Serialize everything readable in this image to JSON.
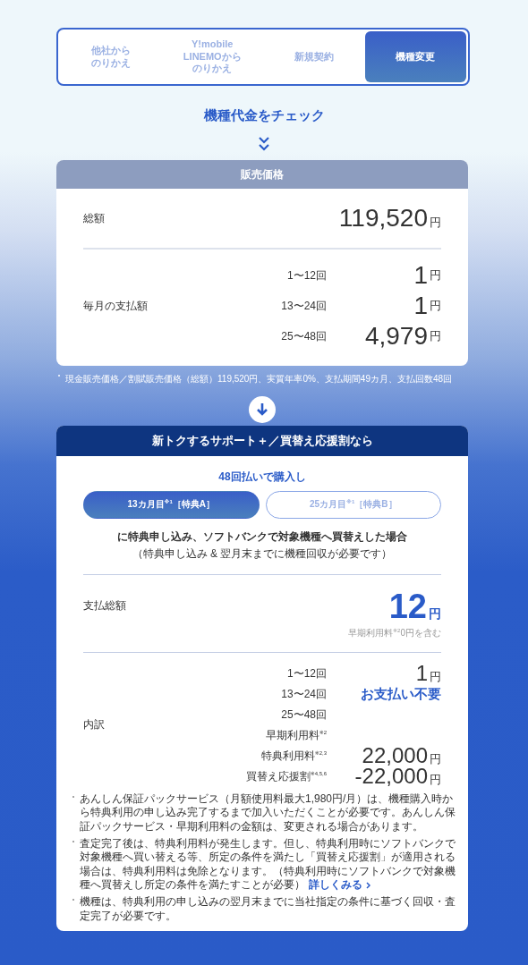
{
  "tabs": [
    {
      "lines": [
        "他社から",
        "のりかえ"
      ],
      "selected": false
    },
    {
      "lines": [
        "Y!mobile",
        "LINEMOから",
        "のりかえ"
      ],
      "selected": false
    },
    {
      "lines": [
        "新規契約"
      ],
      "selected": false
    },
    {
      "lines": [
        "機種変更"
      ],
      "selected": true
    }
  ],
  "heading": "機種代金をチェック",
  "price_card": {
    "title": "販売価格",
    "total": {
      "label": "総額",
      "amount": "119,520",
      "unit": "円"
    },
    "monthly": {
      "label": "毎月の支払額",
      "rows": [
        {
          "period": "1〜12回",
          "amount": "1",
          "unit": "円"
        },
        {
          "period": "13〜24回",
          "amount": "1",
          "unit": "円"
        },
        {
          "period": "25〜48回",
          "amount": "4,979",
          "unit": "円"
        }
      ]
    }
  },
  "price_note": "現金販売価格／割賦販売価格（総額）119,520円、実質年率0%、支払期間49カ月、支払回数48回",
  "plan_card": {
    "title": "新トクするサポート＋／買替え応援割なら",
    "subtitle": "48回払いで購入し",
    "options": [
      {
        "label": "13カ月目$^{※1}$［特典A］",
        "selected": true
      },
      {
        "label": "25カ月目$^{※1}$［特典B］",
        "selected": false
      }
    ],
    "condition": "に特典申し込み、ソフトバンクで対象機種へ買替えした場合",
    "condition_note": "（特典申し込み & 翌月末までに機種回収が必要です）",
    "total": {
      "label": "支払総額",
      "amount": "12",
      "unit": "円",
      "note": "早期利用料$^{※2}$0円を含む"
    },
    "breakdown": {
      "label": "内訳",
      "rows": [
        {
          "label": "1〜12回",
          "kind": "amount",
          "amount": "1",
          "unit": "円"
        },
        {
          "label": "13〜24回",
          "kind": "free",
          "value": "お支払い不要"
        },
        {
          "label": "25〜48回",
          "kind": "none"
        },
        {
          "label": "早期利用料$^{※2}$",
          "kind": "none"
        },
        {
          "label": "特典利用料$^{※2,3}$",
          "kind": "amount",
          "amount": "22,000",
          "unit": "円"
        },
        {
          "label": "買替え応援割$^{※4,5,6}$",
          "kind": "amount",
          "amount": "-22,000",
          "unit": "円"
        }
      ]
    },
    "notes": [
      {
        "text": "あんしん保証パックサービス（月額使用料最大1,980円/月）は、機種購入時から特典利用の申し込み完了するまで加入いただくことが必要です。あんしん保証パックサービス・早期利用料の金額は、変更される場合があります。"
      },
      {
        "text": "査定完了後は、特典利用料が発生します。但し、特典利用時にソフトバンクで対象機種へ買い替える等、所定の条件を満たし「買替え応援割」が適用される場合は、特典利用料は免除となります。（特典利用時にソフトバンクで対象機種へ買替えし所定の条件を満たすことが必要）",
        "link": "詳しくみる"
      },
      {
        "text": "機種は、特典利用の申し込みの翌月末までに当社指定の条件に基づく回収・査定完了が必要です。"
      }
    ]
  }
}
